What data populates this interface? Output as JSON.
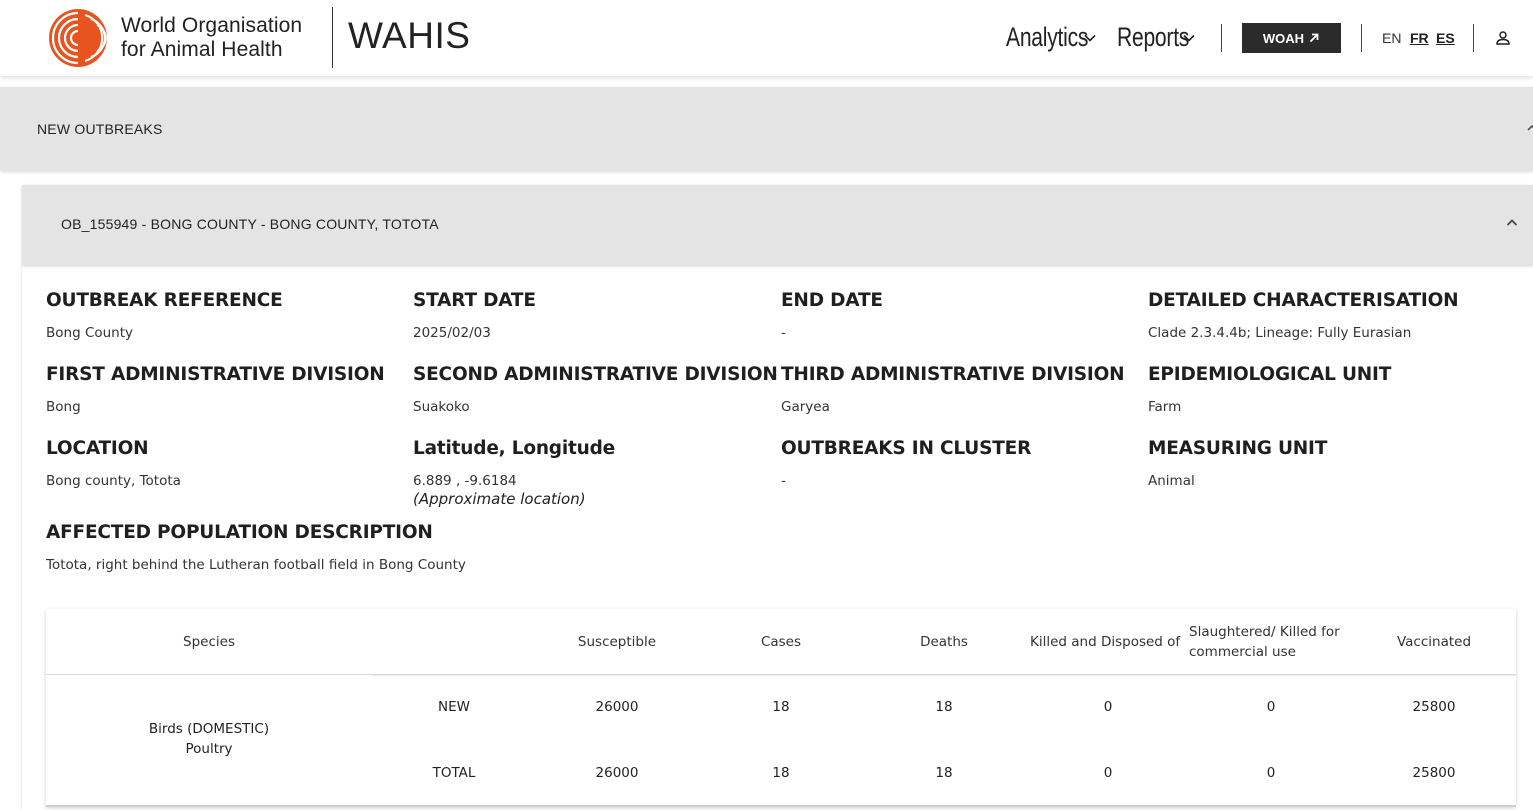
{
  "header": {
    "org_line1": "World Organisation",
    "org_line2": "for Animal Health",
    "app_title": "WAHIS",
    "nav": {
      "analytics": "Analytics",
      "reports": "Reports"
    },
    "woah_button": "WOAH",
    "languages": {
      "en": "EN",
      "fr": "FR",
      "es": "ES"
    },
    "brand_color": "#e8541f"
  },
  "panels": {
    "new_outbreaks": "NEW OUTBREAKS",
    "outbreak_title": "OB_155949 - BONG COUNTY - BONG COUNTY, TOTOTA"
  },
  "fields": {
    "outbreak_reference": {
      "label": "OUTBREAK REFERENCE",
      "value": "Bong County"
    },
    "start_date": {
      "label": "START DATE",
      "value": "2025/02/03"
    },
    "end_date": {
      "label": "END DATE",
      "value": "-"
    },
    "detailed_characterisation": {
      "label": "DETAILED CHARACTERISATION",
      "value": "Clade 2.3.4.4b; Lineage: Fully Eurasian"
    },
    "first_admin": {
      "label": "FIRST ADMINISTRATIVE DIVISION",
      "value": "Bong"
    },
    "second_admin": {
      "label": "SECOND ADMINISTRATIVE DIVISION",
      "value": "Suakoko"
    },
    "third_admin": {
      "label": "THIRD ADMINISTRATIVE DIVISION",
      "value": "Garyea"
    },
    "epi_unit": {
      "label": "EPIDEMIOLOGICAL UNIT",
      "value": "Farm"
    },
    "location": {
      "label": "LOCATION",
      "value": "Bong county, Totota"
    },
    "lat_long": {
      "label": "Latitude, Longitude",
      "value": "6.889 , -9.6184",
      "note": "(Approximate location)"
    },
    "outbreaks_in_cluster": {
      "label": "OUTBREAKS IN CLUSTER",
      "value": "-"
    },
    "measuring_unit": {
      "label": "MEASURING UNIT",
      "value": "Animal"
    },
    "affected_population": {
      "label": "AFFECTED POPULATION DESCRIPTION",
      "value": "Totota, right behind the Lutheran football field in Bong County"
    }
  },
  "table": {
    "headers": {
      "species": "Species",
      "susceptible": "Susceptible",
      "cases": "Cases",
      "deaths": "Deaths",
      "killed": "Killed and Disposed of",
      "slaughtered": "Slaughtered/ Killed for commercial use",
      "vaccinated": "Vaccinated"
    },
    "species_line1": "Birds (DOMESTIC)",
    "species_line2": "Poultry",
    "rows": [
      {
        "type": "NEW",
        "susceptible": "26000",
        "cases": "18",
        "deaths": "18",
        "killed": "0",
        "slaughtered": "0",
        "vaccinated": "25800"
      },
      {
        "type": "TOTAL",
        "susceptible": "26000",
        "cases": "18",
        "deaths": "18",
        "killed": "0",
        "slaughtered": "0",
        "vaccinated": "25800"
      }
    ]
  }
}
